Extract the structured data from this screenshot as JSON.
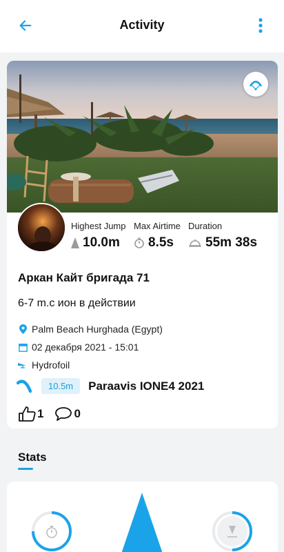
{
  "header": {
    "title": "Activity"
  },
  "stats": {
    "highest_jump": {
      "label": "Highest Jump",
      "value": "10.0m"
    },
    "max_airtime": {
      "label": "Max Airtime",
      "value": "8.5s"
    },
    "duration": {
      "label": "Duration",
      "value": "55m 38s"
    }
  },
  "activity": {
    "title": "Аркан Кайт бригада 71",
    "description": "6-7 m.c ион в действии",
    "location": "Palm Beach Hurghada (Egypt)",
    "datetime": "02 декабря 2021 - 15:01",
    "sport": "Hydrofoil"
  },
  "gear": {
    "size": "10.5m",
    "name": "Paraavis IONE4 2021"
  },
  "social": {
    "likes": "1",
    "comments": "0"
  },
  "stats_section": {
    "title": "Stats"
  },
  "colors": {
    "accent": "#1aa3e8",
    "background": "#f2f3f5",
    "card": "#ffffff"
  },
  "icons": [
    "back-arrow-icon",
    "more-vert-icon",
    "kite-icon",
    "jump-icon",
    "stopwatch-icon",
    "duration-icon",
    "location-pin-icon",
    "calendar-icon",
    "hydrofoil-icon",
    "kite-gear-icon",
    "thumbs-up-icon",
    "comment-icon"
  ]
}
